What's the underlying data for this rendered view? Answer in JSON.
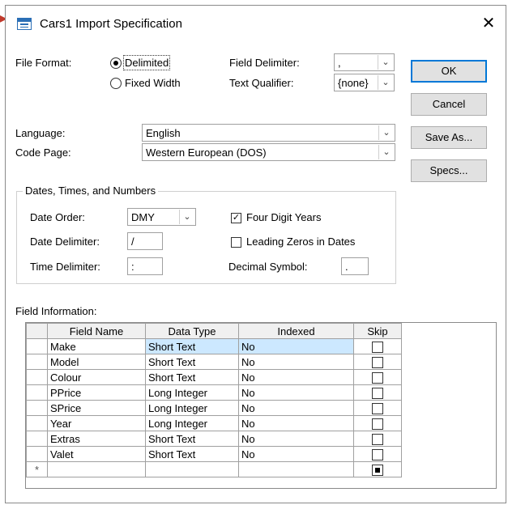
{
  "window": {
    "title": "Cars1 Import Specification",
    "close_glyph": "✕",
    "arrow_glyph": "▶"
  },
  "file_format": {
    "label": "File Format:",
    "options": [
      {
        "label": "Delimited",
        "selected": true
      },
      {
        "label": "Fixed Width",
        "selected": false
      }
    ]
  },
  "field_delimiter": {
    "label": "Field Delimiter:",
    "value": ","
  },
  "text_qualifier": {
    "label": "Text Qualifier:",
    "value": "{none}"
  },
  "language": {
    "label": "Language:",
    "value": "English"
  },
  "code_page": {
    "label": "Code Page:",
    "value": "Western European (DOS)"
  },
  "buttons": {
    "ok": "OK",
    "cancel": "Cancel",
    "save_as": "Save As...",
    "specs": "Specs..."
  },
  "dates_group": {
    "title": "Dates, Times, and Numbers",
    "date_order": {
      "label": "Date Order:",
      "value": "DMY"
    },
    "date_delimiter": {
      "label": "Date Delimiter:",
      "value": "/"
    },
    "time_delimiter": {
      "label": "Time Delimiter:",
      "value": ":"
    },
    "four_digit_years": {
      "label": "Four Digit Years",
      "checked": true
    },
    "leading_zeros": {
      "label": "Leading Zeros in Dates",
      "checked": false
    },
    "decimal_symbol": {
      "label": "Decimal Symbol:",
      "value": "."
    }
  },
  "field_info": {
    "label": "Field Information:",
    "columns": [
      "Field Name",
      "Data Type",
      "Indexed",
      "Skip"
    ],
    "rows": [
      {
        "name": "Make",
        "type": "Short Text",
        "indexed": "No",
        "skip": false
      },
      {
        "name": "Model",
        "type": "Short Text",
        "indexed": "No",
        "skip": false
      },
      {
        "name": "Colour",
        "type": "Short Text",
        "indexed": "No",
        "skip": false
      },
      {
        "name": "PPrice",
        "type": "Long Integer",
        "indexed": "No",
        "skip": false
      },
      {
        "name": "SPrice",
        "type": "Long Integer",
        "indexed": "No",
        "skip": false
      },
      {
        "name": "Year",
        "type": "Long Integer",
        "indexed": "No",
        "skip": false
      },
      {
        "name": "Extras",
        "type": "Short Text",
        "indexed": "No",
        "skip": false
      },
      {
        "name": "Valet",
        "type": "Short Text",
        "indexed": "No",
        "skip": false
      }
    ],
    "new_row_marker": "*"
  },
  "colors": {
    "accent": "#0078d7",
    "selection": "#cce8ff",
    "icon": "#2b6fb6",
    "arrow": "#c0392b"
  },
  "icons": {
    "dropdown": "chevron-down-icon",
    "close": "close-icon",
    "app": "table-icon"
  }
}
